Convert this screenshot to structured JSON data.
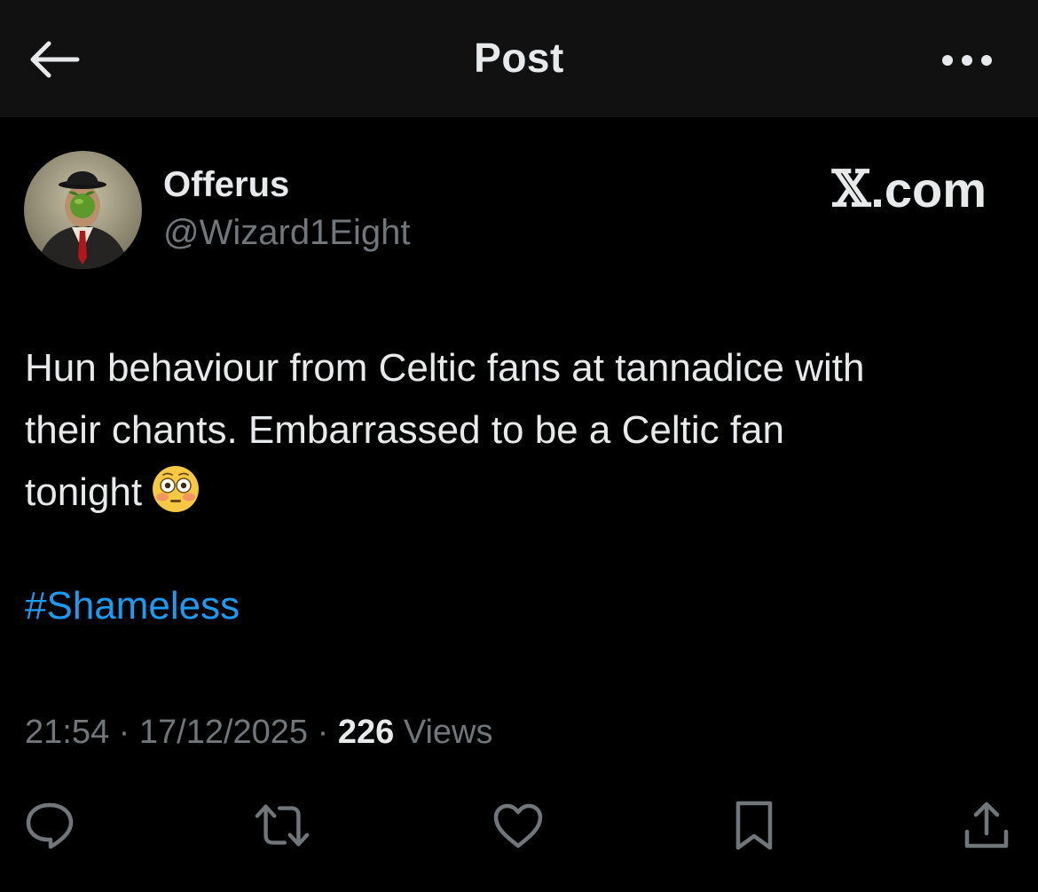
{
  "header": {
    "title": "Post",
    "back_icon": "arrow-left-icon",
    "more_icon": "more-horizontal-icon"
  },
  "author": {
    "display_name": "Offerus",
    "handle": "@Wizard1Eight",
    "avatar_icon": "avatar-image"
  },
  "source": {
    "x_mark": "𝕏",
    "domain": ".com"
  },
  "post": {
    "line1": "Hun behaviour from Celtic fans at tannadice with",
    "line2": "their chants. Embarrassed to be a Celtic fan",
    "line3": "tonight",
    "emoji_icon": "flushed-face-emoji",
    "hashtag": "#Shameless"
  },
  "meta": {
    "time": "21:54",
    "separator": "·",
    "date": "17/12/2025",
    "views_count": "226",
    "views_label": "Views"
  },
  "actions": {
    "reply_icon": "reply-icon",
    "repost_icon": "repost-icon",
    "like_icon": "heart-icon",
    "bookmark_icon": "bookmark-icon",
    "share_icon": "share-icon"
  },
  "colors": {
    "background": "#000000",
    "header_background": "#111111",
    "primary_text": "#e7e9ea",
    "secondary_text": "#71767b",
    "link": "#1d9bf0"
  }
}
